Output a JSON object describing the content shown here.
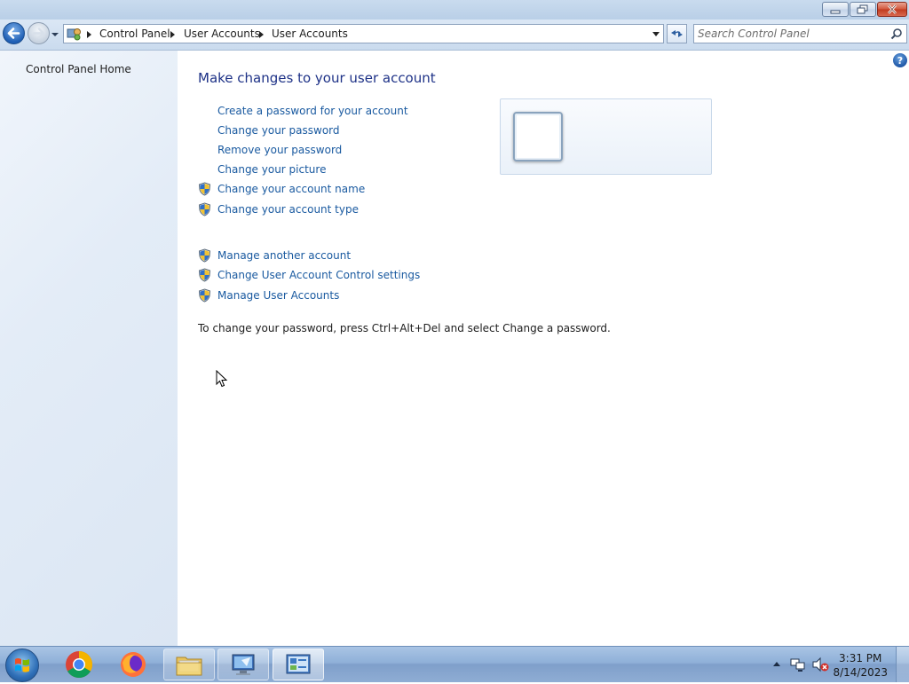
{
  "window": {
    "controls": {
      "minimize": "minimize",
      "maximize": "restore",
      "close": "close"
    }
  },
  "navigation": {
    "breadcrumb": [
      "Control Panel",
      "User Accounts",
      "User Accounts"
    ],
    "search_placeholder": "Search Control Panel"
  },
  "sidebar": {
    "home_link": "Control Panel Home"
  },
  "main": {
    "heading": "Make changes to your user account",
    "links_group1": [
      {
        "label": "Create a password for your account",
        "shield": false
      },
      {
        "label": "Change your password",
        "shield": false
      },
      {
        "label": "Remove your password",
        "shield": false
      },
      {
        "label": "Change your picture",
        "shield": false
      },
      {
        "label": "Change your account name",
        "shield": true
      },
      {
        "label": "Change your account type",
        "shield": true
      }
    ],
    "links_group2": [
      {
        "label": "Manage another account",
        "shield": true
      },
      {
        "label": "Change User Account Control settings",
        "shield": true
      },
      {
        "label": "Manage User Accounts",
        "shield": true
      }
    ],
    "note": "To change your password, press Ctrl+Alt+Del and select Change a password."
  },
  "taskbar": {
    "items": [
      "start-orb",
      "chrome-icon",
      "firefox-icon",
      "explorer-icon",
      "remote-desktop-icon",
      "control-panel-icon"
    ],
    "clock_time": "3:31 PM",
    "clock_date": "8/14/2023"
  },
  "colors": {
    "link": "#1a5aa0",
    "heading": "#1e3287",
    "sidebar_bg": "#e3ecf7",
    "taskbar": "#8fb0d8"
  }
}
